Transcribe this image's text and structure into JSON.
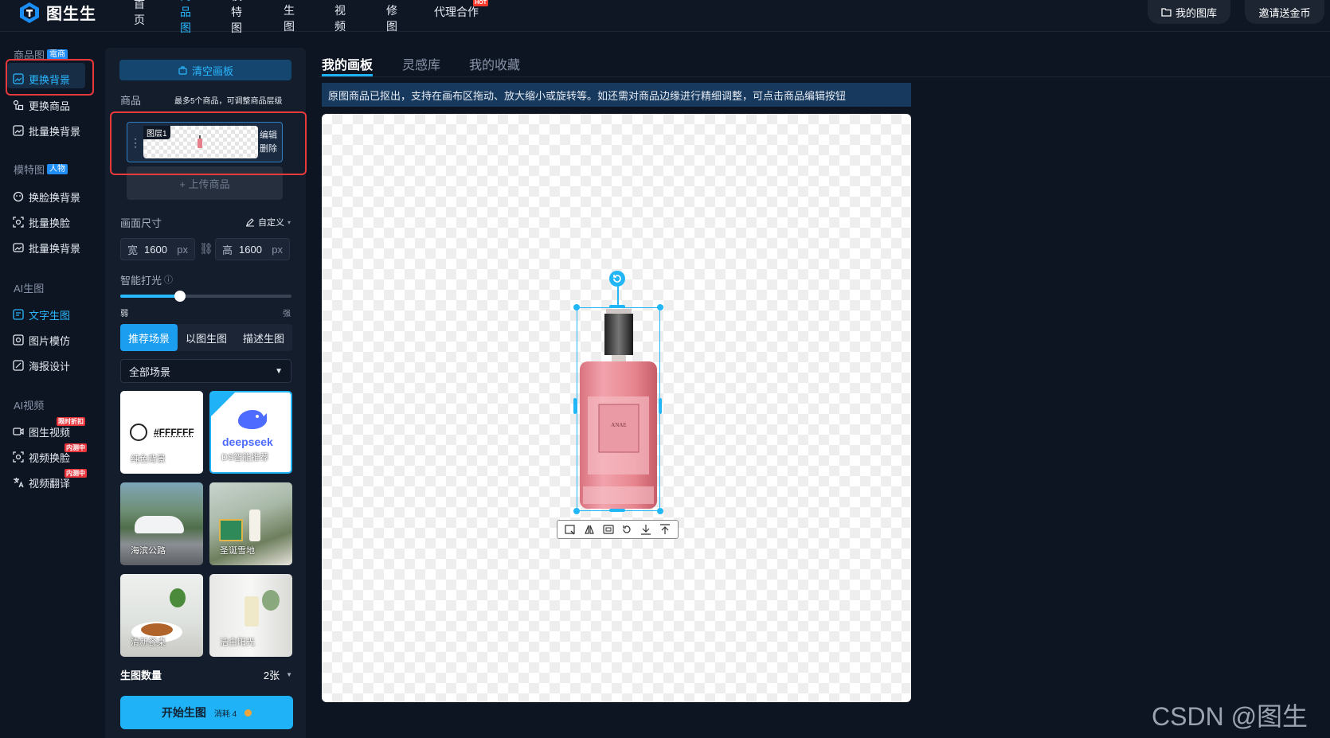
{
  "brand": {
    "name": "图生生"
  },
  "nav": {
    "items": [
      "首页",
      "商品图",
      "模特图",
      "AI生图",
      "AI视频",
      "AI修图",
      "代理合作"
    ],
    "active_index": 1,
    "hot_badge": "HOT",
    "my_gallery": "我的图库",
    "invite": "邀请送金币"
  },
  "sidebar": {
    "groups": [
      {
        "title": "商品图",
        "badge": "電商",
        "items": [
          "更换背景",
          "更换商品",
          "批量换背景"
        ]
      },
      {
        "title": "模特图",
        "badge": "人物",
        "items": [
          "换脸换背景",
          "批量换脸",
          "批量换背景"
        ]
      },
      {
        "title": "AI生图",
        "badge": "",
        "items": [
          "文字生图",
          "图片模仿",
          "海报设计"
        ]
      },
      {
        "title": "AI视频",
        "badge": "",
        "items": [
          "图生视频",
          "视频换脸",
          "视频翻译"
        ]
      }
    ],
    "tags": {
      "limited": "限时折扣",
      "beta1": "内测中",
      "beta2": "内测中"
    },
    "active_item": "更换背景"
  },
  "panel": {
    "clear_canvas": "清空画板",
    "products_label": "商品",
    "products_hint": "最多5个商品，可调整商品层级",
    "layer_tag": "图层1",
    "edit": "编辑",
    "delete": "删除",
    "upload": "+ 上传商品",
    "canvas_size_label": "画面尺寸",
    "custom": "自定义",
    "width_label": "宽",
    "width_value": "1600",
    "height_label": "高",
    "height_value": "1600",
    "unit": "px",
    "lighting_label": "智能打光",
    "lighting_level": 0.35,
    "weak": "弱",
    "strong": "强",
    "mode_tabs": [
      "推荐场景",
      "以图生图",
      "描述生图"
    ],
    "mode_active": 0,
    "scene_filter": "全部场景",
    "scenes": [
      {
        "label": "纯色背景",
        "color_text": "#FFFFFF"
      },
      {
        "label": "DS智能推荐",
        "logo": "deepseek"
      },
      {
        "label": "海滨公路"
      },
      {
        "label": "圣诞雪地"
      },
      {
        "label": "清新餐桌"
      },
      {
        "label": "洁白阳光"
      }
    ],
    "count_label": "生图数量",
    "count_value": "2张",
    "start_button": "开始生图",
    "cost_label": "消耗 4"
  },
  "main": {
    "tabs": [
      "我的画板",
      "灵感库",
      "我的收藏"
    ],
    "active_tab": 0,
    "notice": "原图商品已抠出，支持在画布区拖动、放大缩小或旋转等。如还需对商品边缘进行精细调整，可点击商品编辑按钮"
  },
  "watermark": "CSDN @图生生",
  "colors": {
    "accent": "#1fb2f6",
    "highlight_box": "#e8393b",
    "bg": "#0e1522"
  }
}
